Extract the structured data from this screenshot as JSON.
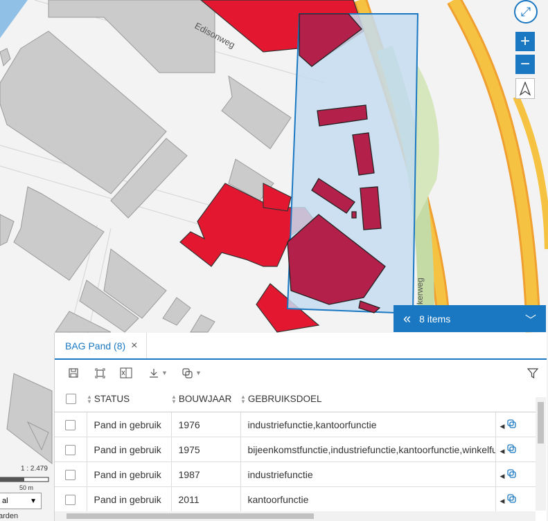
{
  "map": {
    "street_label": "Edisonweg",
    "street_label_2": "kerweg",
    "scale_ratio": "1 : 2.479",
    "scale_bar_label": "50 m",
    "layer_select_value": "al",
    "attribution_fragment": "arden"
  },
  "controls": {
    "zoom_in": "+",
    "zoom_out": "−"
  },
  "selection": {
    "items_label": "8 items"
  },
  "panel": {
    "tab_label": "BAG Pand (8)",
    "columns": [
      "STATUS",
      "BOUWJAAR",
      "GEBRUIKSDOEL"
    ],
    "rows": [
      {
        "status": "Pand in gebruik",
        "bouwjaar": "1976",
        "gebruiksdoel": "industriefunctie,kantoorfunctie"
      },
      {
        "status": "Pand in gebruik",
        "bouwjaar": "1975",
        "gebruiksdoel": "bijeenkomstfunctie,industriefunctie,kantoorfunctie,winkelfunctie"
      },
      {
        "status": "Pand in gebruik",
        "bouwjaar": "1987",
        "gebruiksdoel": "industriefunctie"
      },
      {
        "status": "Pand in gebruik",
        "bouwjaar": "2011",
        "gebruiksdoel": "kantoorfunctie"
      }
    ]
  },
  "colors": {
    "accent": "#1a78c2",
    "building_gray": "#cbcbcb",
    "building_red": "#e3172f",
    "building_selected": "#b3204a",
    "selection_fill": "#c4dcf0",
    "road_yellow": "#f5c242",
    "road_orange": "#f0a030",
    "water": "#90c0e6",
    "green": "#c4dba6"
  }
}
